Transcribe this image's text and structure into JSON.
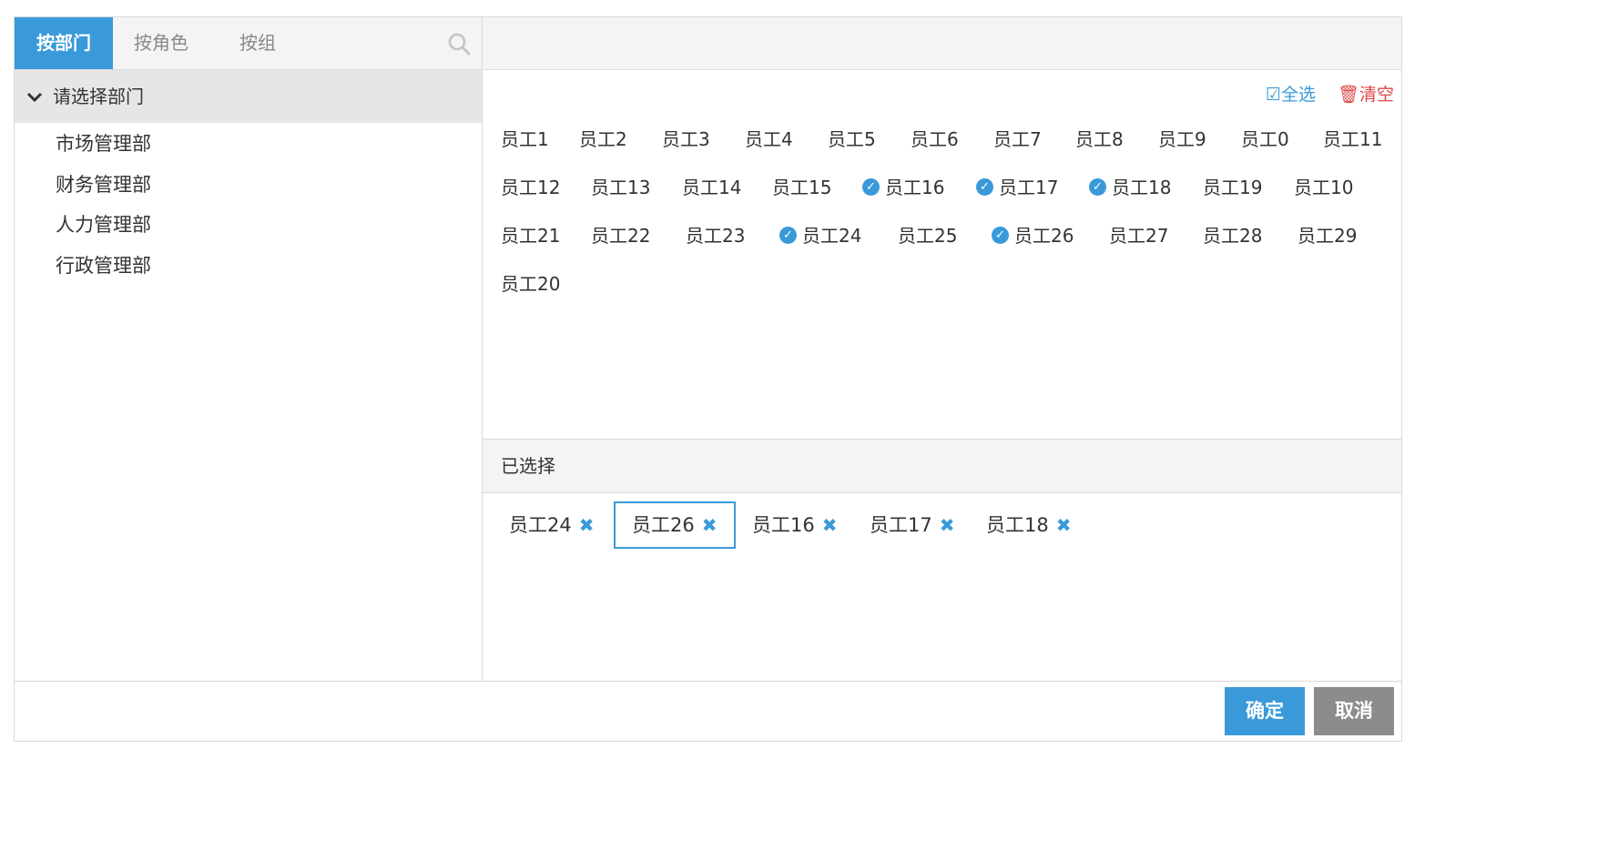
{
  "tabs": [
    {
      "label": "按部门",
      "active": true
    },
    {
      "label": "按角色",
      "active": false
    },
    {
      "label": "按组",
      "active": false
    }
  ],
  "tree": {
    "root_label": "请选择部门",
    "departments": [
      "市场管理部",
      "财务管理部",
      "人力管理部",
      "行政管理部"
    ]
  },
  "toolbar": {
    "select_all": "全选",
    "clear": "清空"
  },
  "employees": [
    {
      "name": "员工1",
      "checked": false
    },
    {
      "name": "员工2",
      "checked": false
    },
    {
      "name": "员工3",
      "checked": false
    },
    {
      "name": "员工4",
      "checked": false
    },
    {
      "name": "员工5",
      "checked": false
    },
    {
      "name": "员工6",
      "checked": false
    },
    {
      "name": "员工7",
      "checked": false
    },
    {
      "name": "员工8",
      "checked": false
    },
    {
      "name": "员工9",
      "checked": false
    },
    {
      "name": "员工0",
      "checked": false
    },
    {
      "name": "员工11",
      "checked": false
    },
    {
      "name": "员工12",
      "checked": false
    },
    {
      "name": "员工13",
      "checked": false
    },
    {
      "name": "员工14",
      "checked": false
    },
    {
      "name": "员工15",
      "checked": false
    },
    {
      "name": "员工16",
      "checked": true
    },
    {
      "name": "员工17",
      "checked": true
    },
    {
      "name": "员工18",
      "checked": true
    },
    {
      "name": "员工19",
      "checked": false
    },
    {
      "name": "员工10",
      "checked": false
    },
    {
      "name": "员工21",
      "checked": false
    },
    {
      "name": "员工22",
      "checked": false
    },
    {
      "name": "员工23",
      "checked": false
    },
    {
      "name": "员工24",
      "checked": true
    },
    {
      "name": "员工25",
      "checked": false
    },
    {
      "name": "员工26",
      "checked": true
    },
    {
      "name": "员工27",
      "checked": false
    },
    {
      "name": "员工28",
      "checked": false
    },
    {
      "name": "员工29",
      "checked": false
    },
    {
      "name": "员工20",
      "checked": false
    }
  ],
  "selected": {
    "title": "已选择",
    "items": [
      "员工24",
      "员工26",
      "员工16",
      "员工17",
      "员工18"
    ],
    "focused": "员工26"
  },
  "buttons": {
    "ok": "确定",
    "cancel": "取消"
  },
  "colors": {
    "accent": "#3a9ad9",
    "danger": "#e04646",
    "cancel": "#8c8c8c"
  }
}
